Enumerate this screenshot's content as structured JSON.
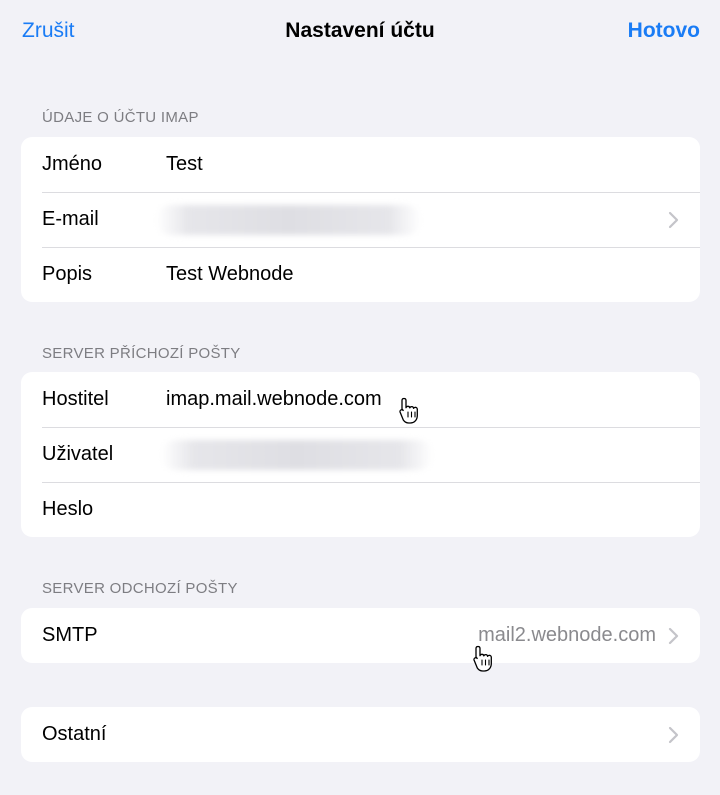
{
  "nav": {
    "cancel_label": "Zrušit",
    "title": "Nastavení účtu",
    "done_label": "Hotovo"
  },
  "imap_section": {
    "header": "ÚDAJE O ÚČTU IMAP",
    "name_label": "Jméno",
    "name_value": "Test",
    "email_label": "E-mail",
    "description_label": "Popis",
    "description_value": "Test Webnode"
  },
  "incoming_section": {
    "header": "SERVER PŘÍCHOZÍ POŠTY",
    "host_label": "Hostitel",
    "host_value": "imap.mail.webnode.com",
    "user_label": "Uživatel",
    "password_label": "Heslo"
  },
  "outgoing_section": {
    "header": "SERVER ODCHOZÍ POŠTY",
    "smtp_label": "SMTP",
    "smtp_value": "mail2.webnode.com"
  },
  "other_section": {
    "other_label": "Ostatní"
  },
  "colors": {
    "accent": "#1a7cf5",
    "background": "#f2f2f7",
    "secondary_text": "#8a8a8e"
  }
}
